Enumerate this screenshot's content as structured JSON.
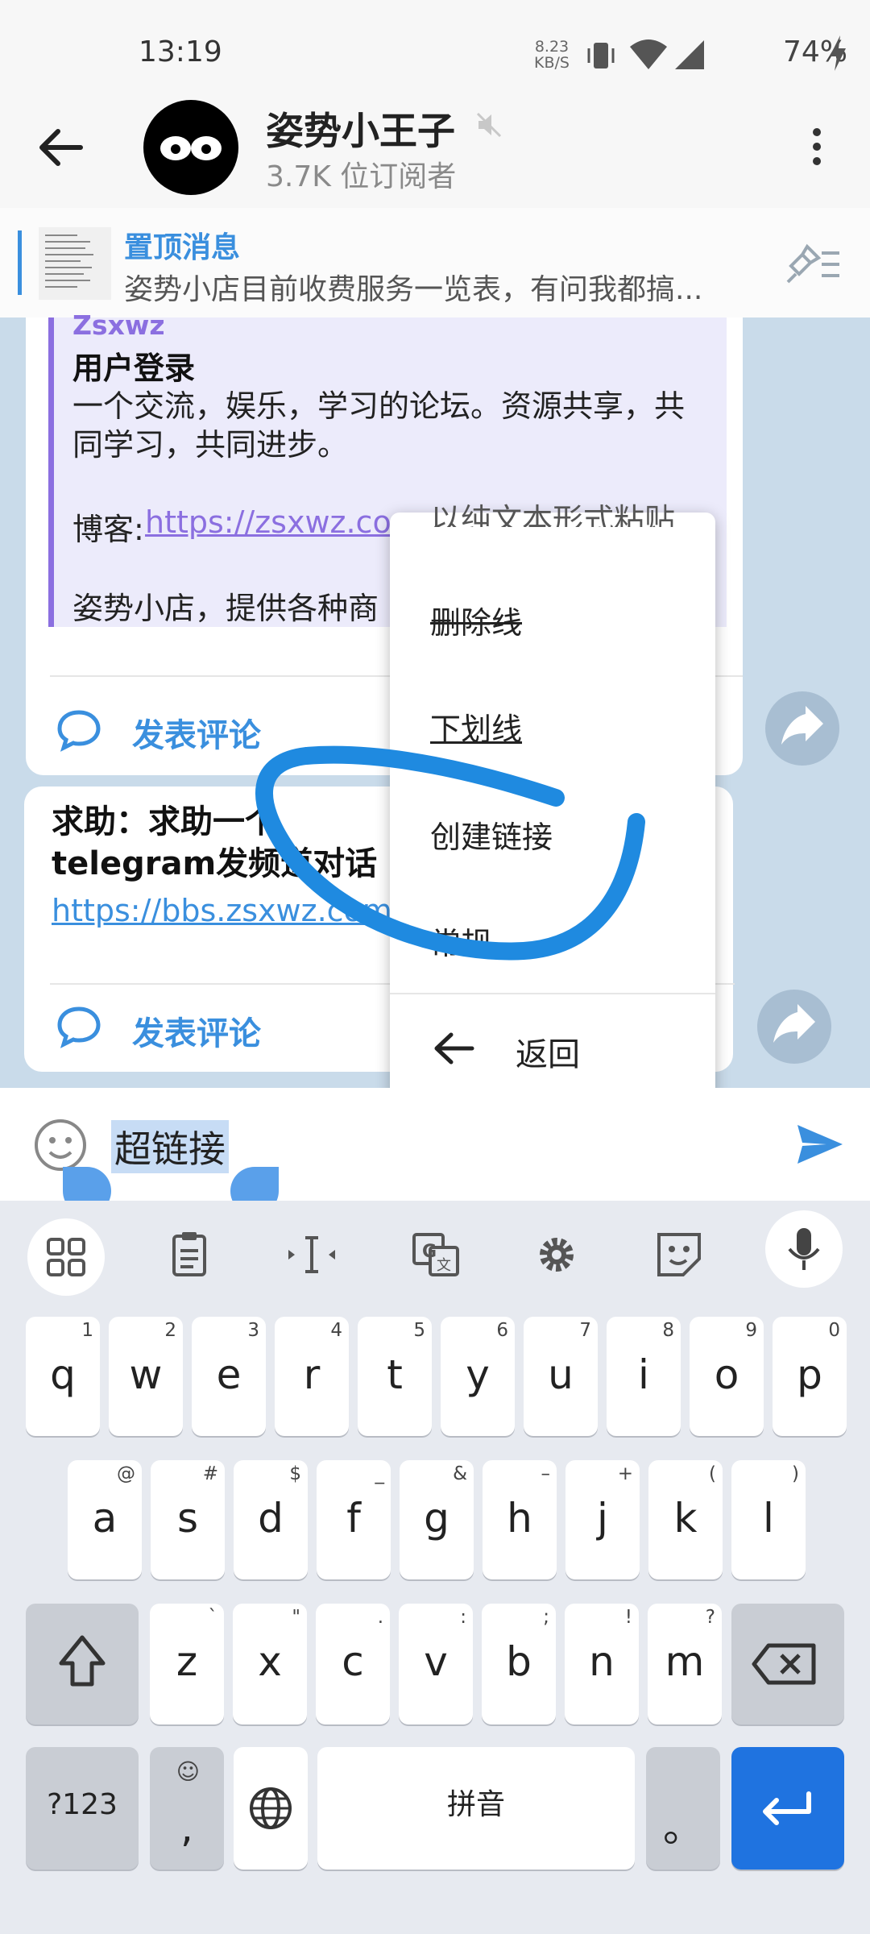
{
  "status": {
    "time": "13:19",
    "net_speed": "8.23",
    "net_unit": "KB/S",
    "battery": "74%"
  },
  "header": {
    "title": "姿势小王子",
    "subtitle": "3.7K 位订阅者"
  },
  "pinned": {
    "title": "置顶消息",
    "text": "姿势小店目前收费服务一览表，有问我都搞..."
  },
  "messages": [
    {
      "quote_name": "Zsxwz",
      "quote_title": "用户登录",
      "quote_desc": "一个交流，娱乐，学习的论坛。资源共享，共同学习，共同进步。",
      "blog_label": "博客:",
      "blog_link": "https://zsxwz.com",
      "shop_text": "姿势小店，提供各种商",
      "comment_label": "发表评论"
    },
    {
      "title": "求助：求助一个telegram发频道对话框的超链接",
      "link": "https://bbs.zsxwz.com",
      "comment_label": "发表评论"
    }
  ],
  "context_menu": {
    "items": [
      "以纯文本形式粘贴",
      "删除线",
      "下划线",
      "创建链接",
      "常规"
    ],
    "back_label": "返回"
  },
  "input": {
    "text": "超链接"
  },
  "keyboard": {
    "row1": [
      [
        "q",
        "1"
      ],
      [
        "w",
        "2"
      ],
      [
        "e",
        "3"
      ],
      [
        "r",
        "4"
      ],
      [
        "t",
        "5"
      ],
      [
        "y",
        "6"
      ],
      [
        "u",
        "7"
      ],
      [
        "i",
        "8"
      ],
      [
        "o",
        "9"
      ],
      [
        "p",
        "0"
      ]
    ],
    "row2": [
      [
        "a",
        "@"
      ],
      [
        "s",
        "#"
      ],
      [
        "d",
        "$"
      ],
      [
        "f",
        "_"
      ],
      [
        "g",
        "&"
      ],
      [
        "h",
        "–"
      ],
      [
        "j",
        "+"
      ],
      [
        "k",
        "("
      ],
      [
        "l",
        ")"
      ]
    ],
    "row3": [
      [
        "z",
        "`"
      ],
      [
        "x",
        "\""
      ],
      [
        "c",
        "."
      ],
      [
        "v",
        ":"
      ],
      [
        "b",
        ";"
      ],
      [
        "n",
        "!"
      ],
      [
        "m",
        "?"
      ]
    ],
    "sym_label": "?123",
    "comma_label": ",",
    "space_label": "拼音",
    "period_label": "。",
    "accent": "#1f73e0"
  }
}
